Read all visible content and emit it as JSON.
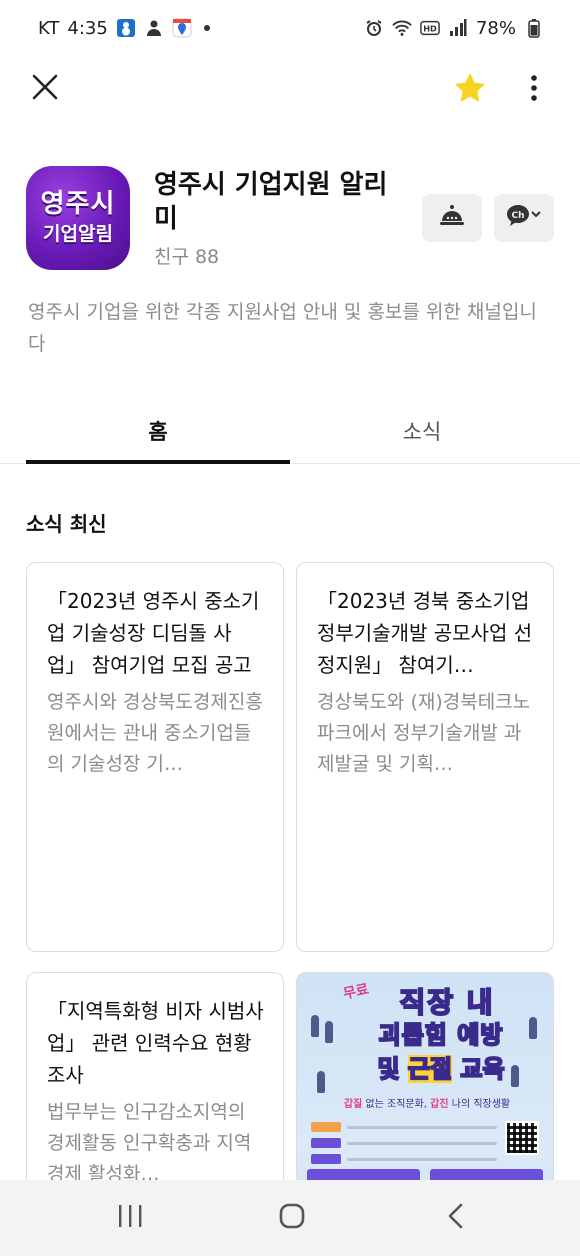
{
  "status_bar": {
    "carrier": "KT",
    "time": "4:35",
    "battery": "78%",
    "icons": [
      "snowman-icon",
      "person-icon",
      "location-app-icon",
      "alarm-icon",
      "wifi-icon",
      "hd-icon",
      "signal-icon",
      "battery-icon"
    ]
  },
  "header": {
    "close_icon": "close-icon",
    "favorite_icon": "star-icon",
    "more_icon": "more-vertical-icon",
    "favorite_color": "#f7d21e"
  },
  "profile": {
    "logo_line1": "영주시",
    "logo_line2": "기업알림",
    "name": "영주시 기업지원 알리미",
    "friends_label": "친구",
    "friends_count": "88",
    "actions": [
      "notification-bell-icon",
      "channel-chat-icon"
    ],
    "chat_label": "Ch"
  },
  "description": "영주시 기업을 위한 각종 지원사업 안내 및 홍보를 위한 채널입니다",
  "tabs": [
    {
      "label": "홈",
      "active": true
    },
    {
      "label": "소식",
      "active": false
    }
  ],
  "section": {
    "title": "소식 최신"
  },
  "cards": [
    {
      "title": "「2023년 영주시 중소기업 기술성장 디딤돌 사업」 참여기업 모집 공고",
      "body": "영주시와 경상북도경제진흥원에서는 관내 중소기업들의 기술성장 기…"
    },
    {
      "title": "「2023년 경북 중소기업 정부기술개발 공모사업 선정지원」 참여기…",
      "body": "경상북도와 (재)경북테크노파크에서 정부기술개발 과제발굴 및 기획…"
    },
    {
      "title": "「지역특화형 비자 시범사업」 관련 인력수요 현황조사",
      "body": "법무부는 인구감소지역의 경제활동 인구확충과 지역경제 활성화…"
    },
    {
      "poster": {
        "free": "무료",
        "head1": "직장 내",
        "head2": "괴롭힘 예방",
        "head3_prefix": "및 ",
        "head3_highlight": "근절",
        "head3_suffix": " 교육",
        "sub_prefix": "갑질",
        "sub_middle": " 없는 조직문화, ",
        "sub_highlight": "갑진",
        "sub_suffix": " 나의 직장생활"
      }
    }
  ],
  "nav_bar": {
    "recent_icon": "recent-apps-icon",
    "home_icon": "home-icon",
    "back_icon": "back-icon"
  }
}
